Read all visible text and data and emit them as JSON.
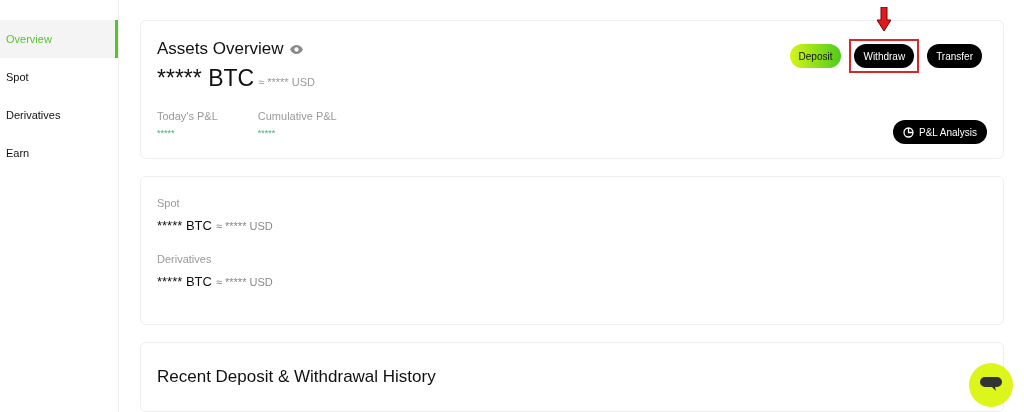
{
  "sidebar": {
    "items": [
      {
        "label": "Overview",
        "selected": true
      },
      {
        "label": "Spot",
        "selected": false
      },
      {
        "label": "Derivatives",
        "selected": false
      },
      {
        "label": "Earn",
        "selected": false
      }
    ]
  },
  "overview": {
    "title": "Assets Overview",
    "amount": "***** BTC",
    "approx": "≈ ***** USD",
    "buttons": [
      {
        "label": "Deposit",
        "kind": "primary",
        "highlighted": false
      },
      {
        "label": "Withdraw",
        "kind": "dark",
        "highlighted": true
      },
      {
        "label": "Transfer",
        "kind": "dark",
        "highlighted": false
      }
    ],
    "pnl": [
      {
        "label": "Today's P&L",
        "value": "*****"
      },
      {
        "label": "Cumulative P&L",
        "value": "*****"
      }
    ],
    "analysis_button": "P&L Analysis"
  },
  "accounts": [
    {
      "label": "Spot",
      "amount": "***** BTC",
      "approx": "≈ ***** USD"
    },
    {
      "label": "Derivatives",
      "amount": "***** BTC",
      "approx": "≈ ***** USD"
    }
  ],
  "history": {
    "title": "Recent Deposit & Withdrawal History"
  }
}
